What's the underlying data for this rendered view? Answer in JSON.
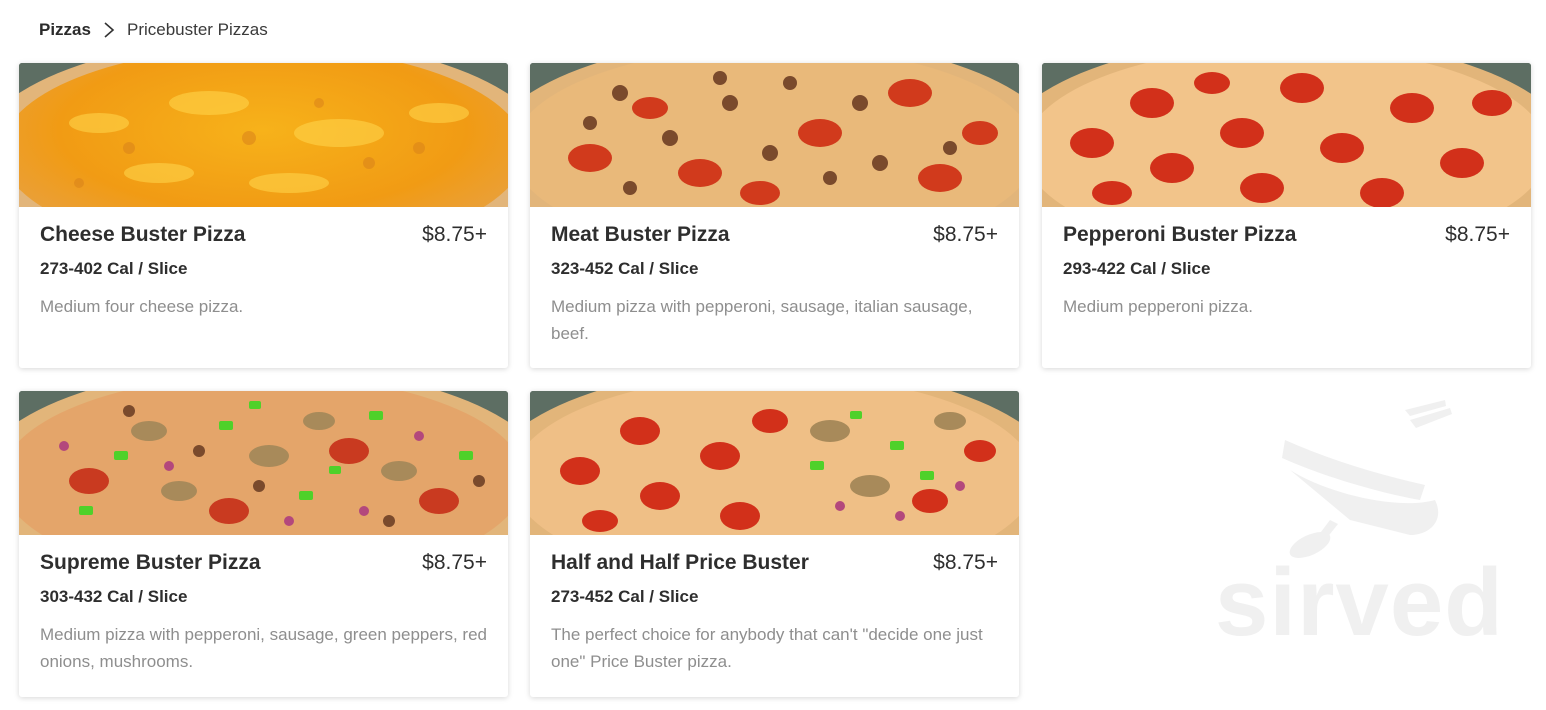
{
  "breadcrumb": {
    "root": "Pizzas",
    "current": "Pricebuster Pizzas"
  },
  "items": [
    {
      "name": "Cheese Buster Pizza",
      "price": "$8.75+",
      "calories": "273-402 Cal / Slice",
      "description": "Medium four cheese pizza.",
      "image": "cheese-pizza-photo"
    },
    {
      "name": "Meat Buster Pizza",
      "price": "$8.75+",
      "calories": "323-452 Cal / Slice",
      "description": "Medium pizza with pepperoni, sausage, italian sausage, beef.",
      "image": "meat-pizza-photo"
    },
    {
      "name": "Pepperoni Buster Pizza",
      "price": "$8.75+",
      "calories": "293-422 Cal / Slice",
      "description": "Medium pepperoni pizza.",
      "image": "pepperoni-pizza-photo"
    },
    {
      "name": "Supreme Buster Pizza",
      "price": "$8.75+",
      "calories": "303-432 Cal / Slice",
      "description": "Medium pizza with pepperoni, sausage, green peppers, red onions, mushrooms.",
      "image": "supreme-pizza-photo"
    },
    {
      "name": "Half and Half Price Buster",
      "price": "$8.75+",
      "calories": "273-452 Cal / Slice",
      "description": "The perfect choice for anybody that can't \"decide one just one\" Price Buster pizza.",
      "image": "half-and-half-pizza-photo"
    }
  ],
  "watermark": {
    "text": "sirved",
    "icon": "knife-fork-spoon-icon"
  }
}
